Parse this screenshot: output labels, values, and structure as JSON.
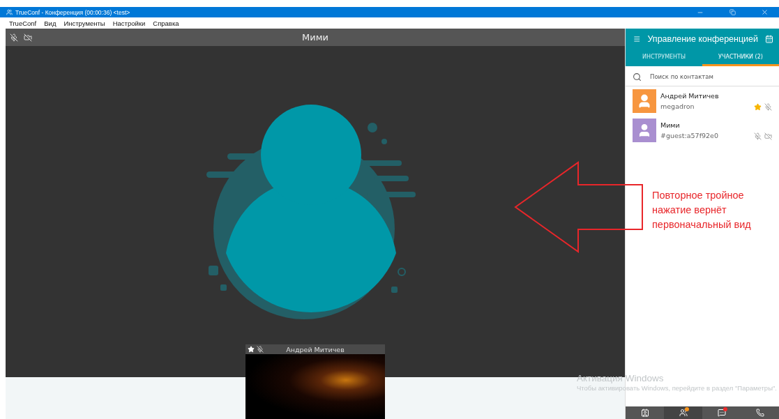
{
  "window": {
    "title": "TrueConf - Конференция (00:00:36) <test>"
  },
  "menu": [
    "TrueConf",
    "Вид",
    "Инструменты",
    "Настройки",
    "Справка"
  ],
  "video": {
    "name": "Мими",
    "mic_muted": true,
    "camera_off": true
  },
  "self_view": {
    "name": "Андрей Митичев",
    "owner": true,
    "mic_muted": true
  },
  "panel": {
    "title": "Управление конференцией",
    "tabs": [
      {
        "label": "ИНСТРУМЕНТЫ",
        "selected": false
      },
      {
        "label": "УЧАСТНИКИ (2)",
        "selected": true
      }
    ],
    "search": {
      "placeholder": "Поиск по контактам"
    },
    "participants": [
      {
        "name": "Андрей Митичев",
        "login": "megadron",
        "color": "#f7963f",
        "guest": false,
        "owner": true,
        "mic_muted": true,
        "camera_off": false
      },
      {
        "name": "Мими",
        "login": "#guest:a57f92e0",
        "color": "#a98fd0",
        "guest": true,
        "owner": false,
        "mic_muted": true,
        "camera_off": true
      }
    ]
  },
  "bottom_nav": [
    {
      "kind": "contacts",
      "selected": false
    },
    {
      "kind": "participants",
      "selected": true,
      "color": "#f7941d"
    },
    {
      "kind": "chat",
      "selected": false,
      "color": "#ee2a2a"
    },
    {
      "kind": "call",
      "selected": false
    }
  ],
  "annotation": {
    "text": "Повторное тройное нажатие вернёт первоначальный вид"
  },
  "activation": {
    "title": "Активация Windows",
    "text": "Чтобы активировать Windows, перейдите в раздел \"Параметры\"."
  }
}
